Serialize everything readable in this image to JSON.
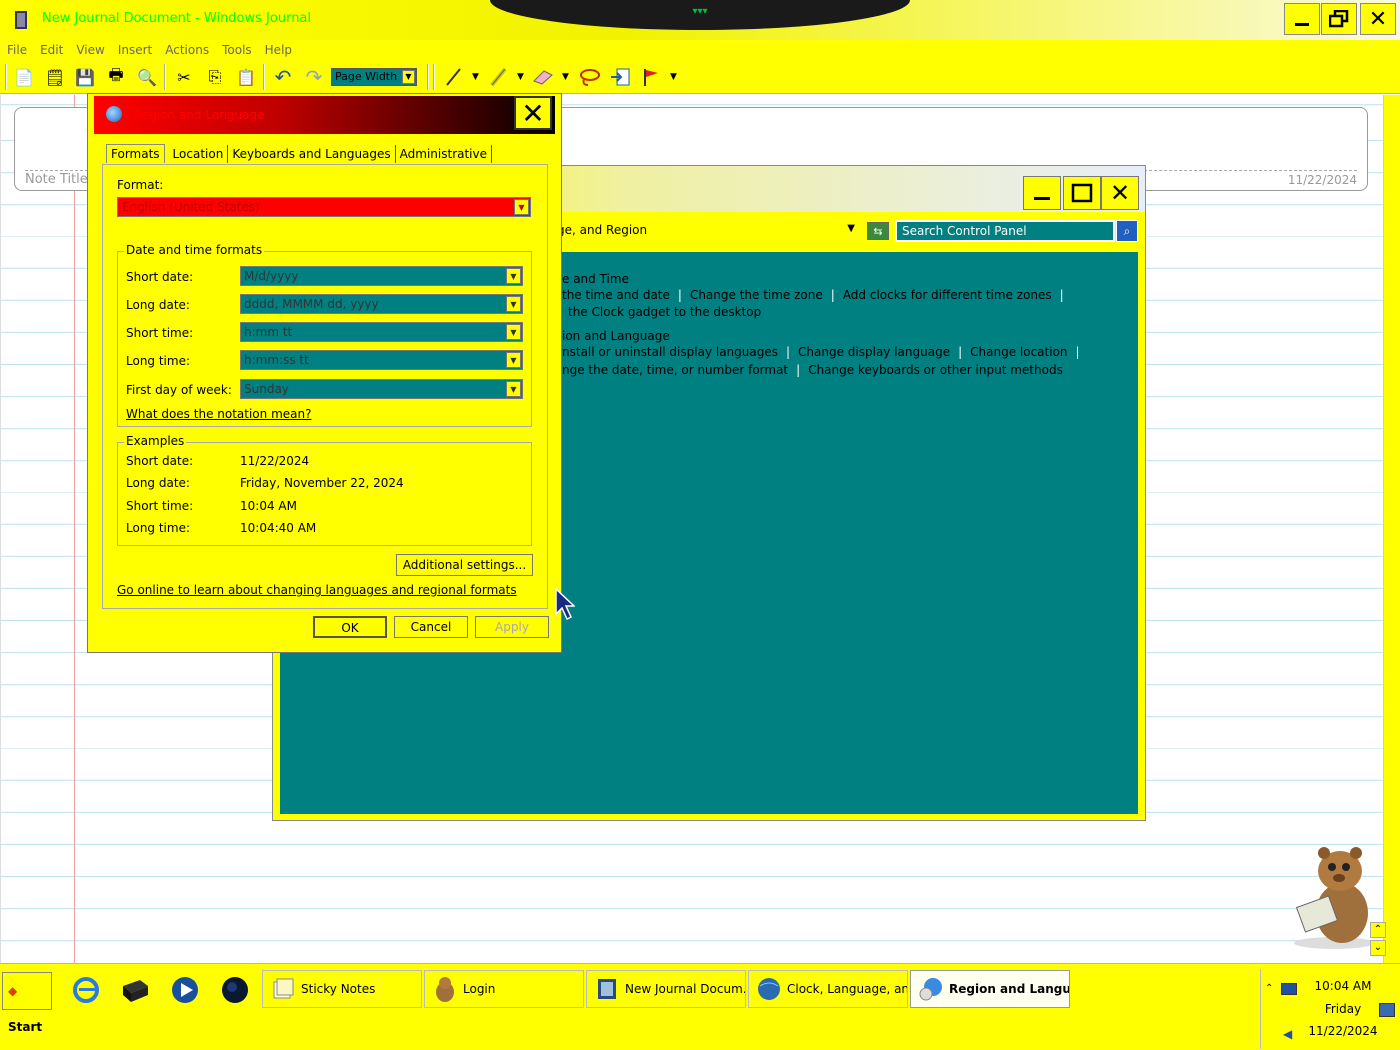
{
  "journal": {
    "title": "New Journal Document - Windows Journal",
    "menu": [
      "File",
      "Edit",
      "View",
      "Insert",
      "Actions",
      "Tools",
      "Help"
    ],
    "zoom": "Page Width",
    "note_title_placeholder": "Note Title",
    "note_date": "11/22/2024"
  },
  "control_panel": {
    "address": "ge, and Region",
    "search_placeholder": "Search Control Panel",
    "lines": [
      "e and Time",
      "the time and date",
      "Change the time zone",
      "Add clocks for different time zones",
      "the Clock gadget to the desktop",
      "ion and Language",
      "nstall or uninstall display languages",
      "Change display language",
      "Change location",
      "nge the date, time, or number format",
      "Change keyboards or other input methods"
    ]
  },
  "region_dialog": {
    "title": "Region and Language",
    "tabs": [
      "Formats",
      "Location",
      "Keyboards and Languages",
      "Administrative"
    ],
    "format_label": "Format:",
    "format_value": "English (United States)",
    "dtf_title": "Date and time formats",
    "fields": [
      {
        "label": "Short date:",
        "value": "M/d/yyyy"
      },
      {
        "label": "Long date:",
        "value": "dddd, MMMM dd, yyyy"
      },
      {
        "label": "Short time:",
        "value": "h:mm tt"
      },
      {
        "label": "Long time:",
        "value": "h:mm:ss tt"
      },
      {
        "label": "First day of week:",
        "value": "Sunday"
      }
    ],
    "notation_link": "What does the notation mean?",
    "examples_title": "Examples",
    "examples": [
      {
        "label": "Short date:",
        "value": "11/22/2024"
      },
      {
        "label": "Long date:",
        "value": "Friday, November 22, 2024"
      },
      {
        "label": "Short time:",
        "value": "10:04 AM"
      },
      {
        "label": "Long time:",
        "value": "10:04:40 AM"
      }
    ],
    "additional_btn": "Additional settings...",
    "online_link": "Go online to learn about changing languages and regional formats",
    "ok": "OK",
    "cancel": "Cancel",
    "apply": "Apply"
  },
  "taskbar": {
    "start": "Start",
    "tasks": [
      "Sticky Notes",
      "Login",
      "New Journal Docum...",
      "Clock, Language, an...",
      "Region and Langua..."
    ],
    "clock_time": "10:04 AM",
    "clock_day": "Friday",
    "clock_date": "11/22/2024"
  }
}
